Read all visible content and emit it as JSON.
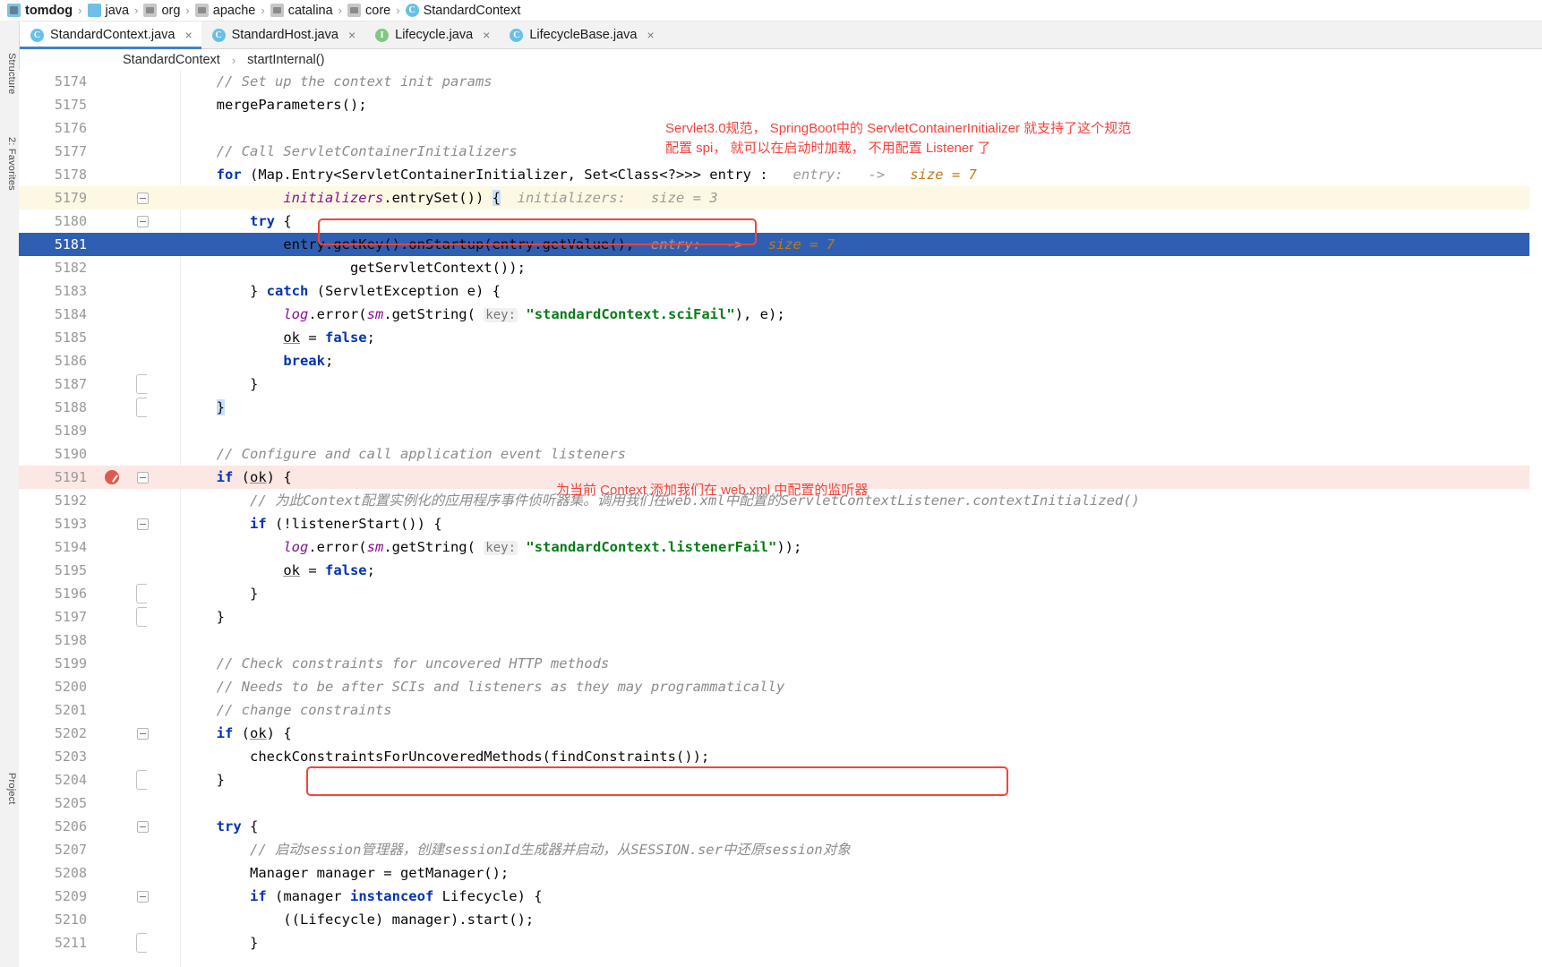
{
  "window": {
    "breadcrumb": [
      {
        "label": "tomdog",
        "icon": "module-icon",
        "bold": true
      },
      {
        "label": "java",
        "icon": "folder-blue-icon",
        "bold": false
      },
      {
        "label": "org",
        "icon": "folder-grey-icon",
        "bold": false
      },
      {
        "label": "apache",
        "icon": "folder-grey-icon",
        "bold": false
      },
      {
        "label": "catalina",
        "icon": "folder-grey-icon",
        "bold": false
      },
      {
        "label": "core",
        "icon": "folder-grey-icon",
        "bold": false
      },
      {
        "label": "StandardContext",
        "icon": "class-icon",
        "bold": false
      }
    ],
    "separator": "›"
  },
  "tabs": [
    {
      "label": "StandardContext.java",
      "icon": "class-icon",
      "kind": "C",
      "active": true,
      "close": "×"
    },
    {
      "label": "StandardHost.java",
      "icon": "class-icon",
      "kind": "C",
      "active": false,
      "close": "×"
    },
    {
      "label": "Lifecycle.java",
      "icon": "interface-icon",
      "kind": "I",
      "active": false,
      "close": "×"
    },
    {
      "label": "LifecycleBase.java",
      "icon": "class-icon",
      "kind": "C",
      "active": false,
      "close": "×"
    }
  ],
  "structure_breadcrumb": {
    "class": "StandardContext",
    "separator": "›",
    "method": "startInternal()"
  },
  "left_stripe": [
    {
      "label": "Structure"
    },
    {
      "label": "2: Favorites"
    },
    {
      "label": "Project"
    }
  ],
  "annotations": [
    {
      "name": "servlet30-note",
      "lines": [
        "Servlet3.0规范， SpringBoot中的 ServletContainerInitializer 就支持了这个规范",
        "配置 spi， 就可以在启动时加载， 不用配置 Listener 了"
      ]
    },
    {
      "name": "listener-note",
      "lines": [
        "为当前 Context 添加我们在 web.xml 中配置的监听器"
      ]
    }
  ],
  "editor": {
    "lines": [
      {
        "num": "5174",
        "row": "normal",
        "fold": "none",
        "tokens": [
          {
            "t": "        ",
            "c": "plain"
          },
          {
            "t": "// Set up the context init params",
            "c": "cmt"
          }
        ]
      },
      {
        "num": "5175",
        "row": "normal",
        "fold": "none",
        "tokens": [
          {
            "t": "        mergeParameters();",
            "c": "plain"
          }
        ]
      },
      {
        "num": "5176",
        "row": "normal",
        "fold": "none",
        "tokens": [
          {
            "t": "",
            "c": "plain"
          }
        ]
      },
      {
        "num": "5177",
        "row": "normal",
        "fold": "none",
        "tokens": [
          {
            "t": "        ",
            "c": "plain"
          },
          {
            "t": "// Call ServletContainerInitializers",
            "c": "cmt"
          }
        ]
      },
      {
        "num": "5178",
        "row": "normal",
        "fold": "none",
        "tokens": [
          {
            "t": "        ",
            "c": "plain"
          },
          {
            "t": "for",
            "c": "kw"
          },
          {
            "t": " (Map.Entry<ServletContainerInitializer, Set<Class<?>>> entry : ",
            "c": "plain"
          },
          {
            "t": "  entry:   ->   ",
            "c": "dbg"
          },
          {
            "t": "size = 7",
            "c": "dbgval"
          }
        ]
      },
      {
        "num": "5179",
        "row": "caret",
        "fold": "minus",
        "tokens": [
          {
            "t": "                ",
            "c": "plain"
          },
          {
            "t": "initializers",
            "c": "fld"
          },
          {
            "t": ".entrySet()) ",
            "c": "plain"
          },
          {
            "t": "{",
            "c": "brace-hl"
          },
          {
            "t": "  initializers:   size = 3",
            "c": "dbg"
          }
        ]
      },
      {
        "num": "5180",
        "row": "normal",
        "fold": "minus",
        "tokens": [
          {
            "t": "            ",
            "c": "plain"
          },
          {
            "t": "try",
            "c": "kw"
          },
          {
            "t": " {",
            "c": "plain"
          }
        ]
      },
      {
        "num": "5181",
        "row": "selected",
        "fold": "none",
        "tokens": [
          {
            "t": "                entry.getKey().onStartup(entry.getValue(),",
            "c": "plain"
          },
          {
            "t": "  entry:   ->   ",
            "c": "dbg"
          },
          {
            "t": "size = 7",
            "c": "dbgval"
          }
        ]
      },
      {
        "num": "5182",
        "row": "normal",
        "fold": "none",
        "tokens": [
          {
            "t": "                        getServletContext());",
            "c": "plain"
          }
        ]
      },
      {
        "num": "5183",
        "row": "normal",
        "fold": "none",
        "tokens": [
          {
            "t": "            } ",
            "c": "plain"
          },
          {
            "t": "catch",
            "c": "kw"
          },
          {
            "t": " (ServletException e) {",
            "c": "plain"
          }
        ]
      },
      {
        "num": "5184",
        "row": "normal",
        "fold": "none",
        "tokens": [
          {
            "t": "                ",
            "c": "plain"
          },
          {
            "t": "log",
            "c": "sfld"
          },
          {
            "t": ".error(",
            "c": "plain"
          },
          {
            "t": "sm",
            "c": "sfld"
          },
          {
            "t": ".getString( ",
            "c": "plain"
          },
          {
            "t": "key:",
            "c": "hintkey"
          },
          {
            "t": " ",
            "c": "plain"
          },
          {
            "t": "\"standardContext.sciFail\"",
            "c": "str"
          },
          {
            "t": "), e);",
            "c": "plain"
          }
        ]
      },
      {
        "num": "5185",
        "row": "normal",
        "fold": "none",
        "tokens": [
          {
            "t": "                ",
            "c": "plain"
          },
          {
            "t": "ok",
            "c": "underln"
          },
          {
            "t": " = ",
            "c": "plain"
          },
          {
            "t": "false",
            "c": "kw"
          },
          {
            "t": ";",
            "c": "plain"
          }
        ]
      },
      {
        "num": "5186",
        "row": "normal",
        "fold": "none",
        "tokens": [
          {
            "t": "                ",
            "c": "plain"
          },
          {
            "t": "break",
            "c": "kw"
          },
          {
            "t": ";",
            "c": "plain"
          }
        ]
      },
      {
        "num": "5187",
        "row": "normal",
        "fold": "brace",
        "tokens": [
          {
            "t": "            }",
            "c": "plain"
          }
        ]
      },
      {
        "num": "5188",
        "row": "normal",
        "fold": "brace",
        "tokens": [
          {
            "t": "        ",
            "c": "plain"
          },
          {
            "t": "}",
            "c": "brace-hl"
          }
        ]
      },
      {
        "num": "5189",
        "row": "normal",
        "fold": "none",
        "tokens": [
          {
            "t": "",
            "c": "plain"
          }
        ]
      },
      {
        "num": "5190",
        "row": "normal",
        "fold": "none",
        "tokens": [
          {
            "t": "        ",
            "c": "plain"
          },
          {
            "t": "// Configure and call application event listeners",
            "c": "cmt"
          }
        ]
      },
      {
        "num": "5191",
        "row": "bp",
        "fold": "minus",
        "breakpoint": true,
        "tokens": [
          {
            "t": "        ",
            "c": "plain"
          },
          {
            "t": "if",
            "c": "kw"
          },
          {
            "t": " (",
            "c": "plain"
          },
          {
            "t": "ok",
            "c": "underln"
          },
          {
            "t": ") {",
            "c": "plain"
          }
        ]
      },
      {
        "num": "5192",
        "row": "normal",
        "fold": "none",
        "tokens": [
          {
            "t": "            ",
            "c": "plain"
          },
          {
            "t": "// 为此Context配置实例化的应用程序事件侦听器集。调用我们在web.xml中配置的ServletContextListener.contextInitialized()",
            "c": "cmt"
          }
        ]
      },
      {
        "num": "5193",
        "row": "normal",
        "fold": "minus",
        "tokens": [
          {
            "t": "            ",
            "c": "plain"
          },
          {
            "t": "if",
            "c": "kw"
          },
          {
            "t": " (!listenerStart()) {",
            "c": "plain"
          }
        ]
      },
      {
        "num": "5194",
        "row": "normal",
        "fold": "none",
        "tokens": [
          {
            "t": "                ",
            "c": "plain"
          },
          {
            "t": "log",
            "c": "sfld"
          },
          {
            "t": ".error(",
            "c": "plain"
          },
          {
            "t": "sm",
            "c": "sfld"
          },
          {
            "t": ".getString( ",
            "c": "plain"
          },
          {
            "t": "key:",
            "c": "hintkey"
          },
          {
            "t": " ",
            "c": "plain"
          },
          {
            "t": "\"standardContext.listenerFail\"",
            "c": "str"
          },
          {
            "t": "));",
            "c": "plain"
          }
        ]
      },
      {
        "num": "5195",
        "row": "normal",
        "fold": "none",
        "tokens": [
          {
            "t": "                ",
            "c": "plain"
          },
          {
            "t": "ok",
            "c": "underln"
          },
          {
            "t": " = ",
            "c": "plain"
          },
          {
            "t": "false",
            "c": "kw"
          },
          {
            "t": ";",
            "c": "plain"
          }
        ]
      },
      {
        "num": "5196",
        "row": "normal",
        "fold": "brace",
        "tokens": [
          {
            "t": "            }",
            "c": "plain"
          }
        ]
      },
      {
        "num": "5197",
        "row": "normal",
        "fold": "brace",
        "tokens": [
          {
            "t": "        }",
            "c": "plain"
          }
        ]
      },
      {
        "num": "5198",
        "row": "normal",
        "fold": "none",
        "tokens": [
          {
            "t": "",
            "c": "plain"
          }
        ]
      },
      {
        "num": "5199",
        "row": "normal",
        "fold": "none",
        "tokens": [
          {
            "t": "        ",
            "c": "plain"
          },
          {
            "t": "// Check constraints for uncovered HTTP methods",
            "c": "cmt"
          }
        ]
      },
      {
        "num": "5200",
        "row": "normal",
        "fold": "none",
        "tokens": [
          {
            "t": "        ",
            "c": "plain"
          },
          {
            "t": "// Needs to be after SCIs and listeners as they may programmatically",
            "c": "cmt"
          }
        ]
      },
      {
        "num": "5201",
        "row": "normal",
        "fold": "none",
        "tokens": [
          {
            "t": "        ",
            "c": "plain"
          },
          {
            "t": "// change constraints",
            "c": "cmt"
          }
        ]
      },
      {
        "num": "5202",
        "row": "normal",
        "fold": "minus",
        "tokens": [
          {
            "t": "        ",
            "c": "plain"
          },
          {
            "t": "if",
            "c": "kw"
          },
          {
            "t": " (",
            "c": "plain"
          },
          {
            "t": "ok",
            "c": "underln"
          },
          {
            "t": ") {",
            "c": "plain"
          }
        ]
      },
      {
        "num": "5203",
        "row": "normal",
        "fold": "none",
        "tokens": [
          {
            "t": "            checkConstraintsForUncoveredMethods(findConstraints());",
            "c": "plain"
          }
        ]
      },
      {
        "num": "5204",
        "row": "normal",
        "fold": "brace",
        "tokens": [
          {
            "t": "        }",
            "c": "plain"
          }
        ]
      },
      {
        "num": "5205",
        "row": "normal",
        "fold": "none",
        "tokens": [
          {
            "t": "",
            "c": "plain"
          }
        ]
      },
      {
        "num": "5206",
        "row": "normal",
        "fold": "minus",
        "tokens": [
          {
            "t": "        ",
            "c": "plain"
          },
          {
            "t": "try",
            "c": "kw"
          },
          {
            "t": " {",
            "c": "plain"
          }
        ]
      },
      {
        "num": "5207",
        "row": "normal",
        "fold": "none",
        "tokens": [
          {
            "t": "            ",
            "c": "plain"
          },
          {
            "t": "// 启动session管理器，创建sessionId生成器并启动，从SESSION.ser中还原session对象",
            "c": "cmt"
          }
        ]
      },
      {
        "num": "5208",
        "row": "normal",
        "fold": "none",
        "tokens": [
          {
            "t": "            Manager manager = getManager();",
            "c": "plain"
          }
        ]
      },
      {
        "num": "5209",
        "row": "normal",
        "fold": "minus",
        "tokens": [
          {
            "t": "            ",
            "c": "plain"
          },
          {
            "t": "if",
            "c": "kw"
          },
          {
            "t": " (manager ",
            "c": "plain"
          },
          {
            "t": "instanceof",
            "c": "kw"
          },
          {
            "t": " Lifecycle) {",
            "c": "plain"
          }
        ]
      },
      {
        "num": "5210",
        "row": "normal",
        "fold": "none",
        "tokens": [
          {
            "t": "                ((Lifecycle) manager).start();",
            "c": "plain"
          }
        ]
      },
      {
        "num": "5211",
        "row": "normal",
        "fold": "brace",
        "tokens": [
          {
            "t": "            }",
            "c": "plain"
          }
        ]
      }
    ]
  },
  "colors": {
    "accent": "#4083c9",
    "selection": "#2f5fb3",
    "annotation_red": "#f4433c",
    "caret_row": "#fdf8e3",
    "breakpoint_row": "#fbe7e3",
    "keyword": "#0033b3",
    "string": "#067d17",
    "comment": "#8c8c8c",
    "field": "#871094"
  }
}
